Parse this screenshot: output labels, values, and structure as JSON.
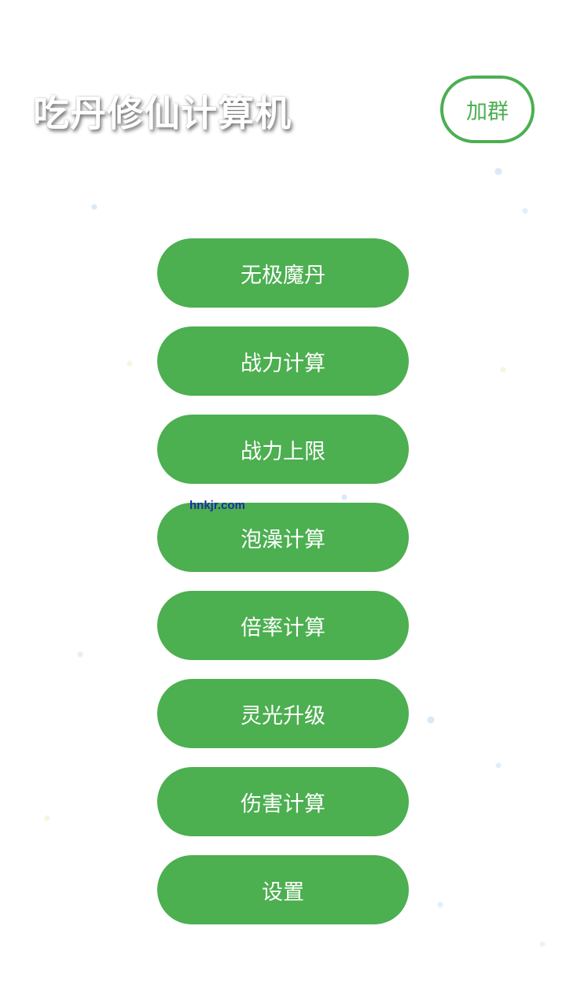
{
  "header": {
    "title": "吃丹修仙计算机",
    "join_label": "加群"
  },
  "menu": {
    "items": [
      {
        "label": "无极魔丹"
      },
      {
        "label": "战力计算"
      },
      {
        "label": "战力上限"
      },
      {
        "label": "泡澡计算"
      },
      {
        "label": "倍率计算"
      },
      {
        "label": "灵光升级"
      },
      {
        "label": "伤害计算"
      },
      {
        "label": "设置"
      }
    ]
  },
  "watermark": "hnkjr.com",
  "colors": {
    "accent": "#4caf50",
    "background": "#ffffff",
    "watermark": "#1b2fa0"
  }
}
